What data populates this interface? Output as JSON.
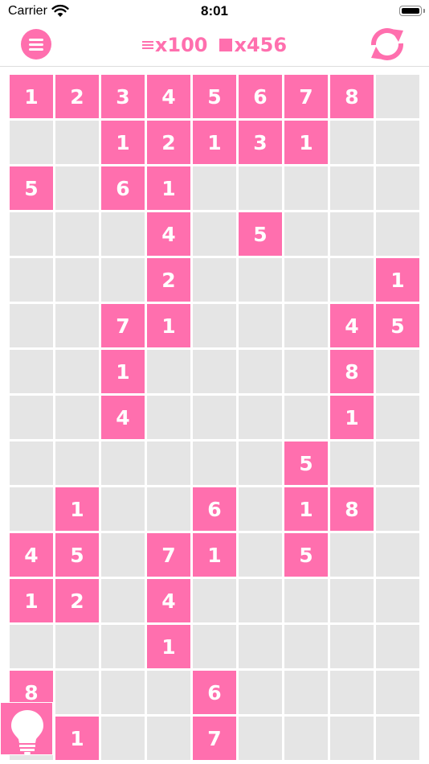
{
  "status_bar": {
    "carrier": "Carrier",
    "time": "8:01"
  },
  "header": {
    "moves_count": "x100",
    "blocks_count": "x456",
    "accent_color": "#ff6fae"
  },
  "icons": {
    "menu": "menu-icon",
    "moves": "moves-icon",
    "blocks": "blocks-icon",
    "refresh": "refresh-icon",
    "hint": "lightbulb-icon",
    "wifi": "wifi-icon",
    "battery": "battery-icon"
  },
  "board": {
    "columns": 9,
    "visible_rows": 15,
    "filled_color": "#ff6fae",
    "empty_color": "#e5e5e5",
    "rows": [
      [
        "1",
        "2",
        "3",
        "4",
        "5",
        "6",
        "7",
        "8",
        null
      ],
      [
        null,
        null,
        "1",
        "2",
        "1",
        "3",
        "1",
        null,
        null
      ],
      [
        "5",
        null,
        "6",
        "1",
        null,
        null,
        null,
        null,
        null
      ],
      [
        null,
        null,
        null,
        "4",
        null,
        "5",
        null,
        null,
        null
      ],
      [
        null,
        null,
        null,
        "2",
        null,
        null,
        null,
        null,
        "1"
      ],
      [
        null,
        null,
        "7",
        "1",
        null,
        null,
        null,
        "4",
        "5"
      ],
      [
        null,
        null,
        "1",
        null,
        null,
        null,
        null,
        "8",
        null
      ],
      [
        null,
        null,
        "4",
        null,
        null,
        null,
        null,
        "1",
        null
      ],
      [
        null,
        null,
        null,
        null,
        null,
        null,
        "5",
        null,
        null
      ],
      [
        null,
        "1",
        null,
        null,
        "6",
        null,
        "1",
        "8",
        null
      ],
      [
        "4",
        "5",
        null,
        "7",
        "1",
        null,
        "5",
        null,
        null
      ],
      [
        "1",
        "2",
        null,
        "4",
        null,
        null,
        null,
        null,
        null
      ],
      [
        null,
        null,
        null,
        "1",
        null,
        null,
        null,
        null,
        null
      ],
      [
        "8",
        null,
        null,
        null,
        "6",
        null,
        null,
        null,
        null
      ],
      [
        null,
        "1",
        null,
        null,
        "7",
        null,
        null,
        null,
        null
      ]
    ]
  }
}
